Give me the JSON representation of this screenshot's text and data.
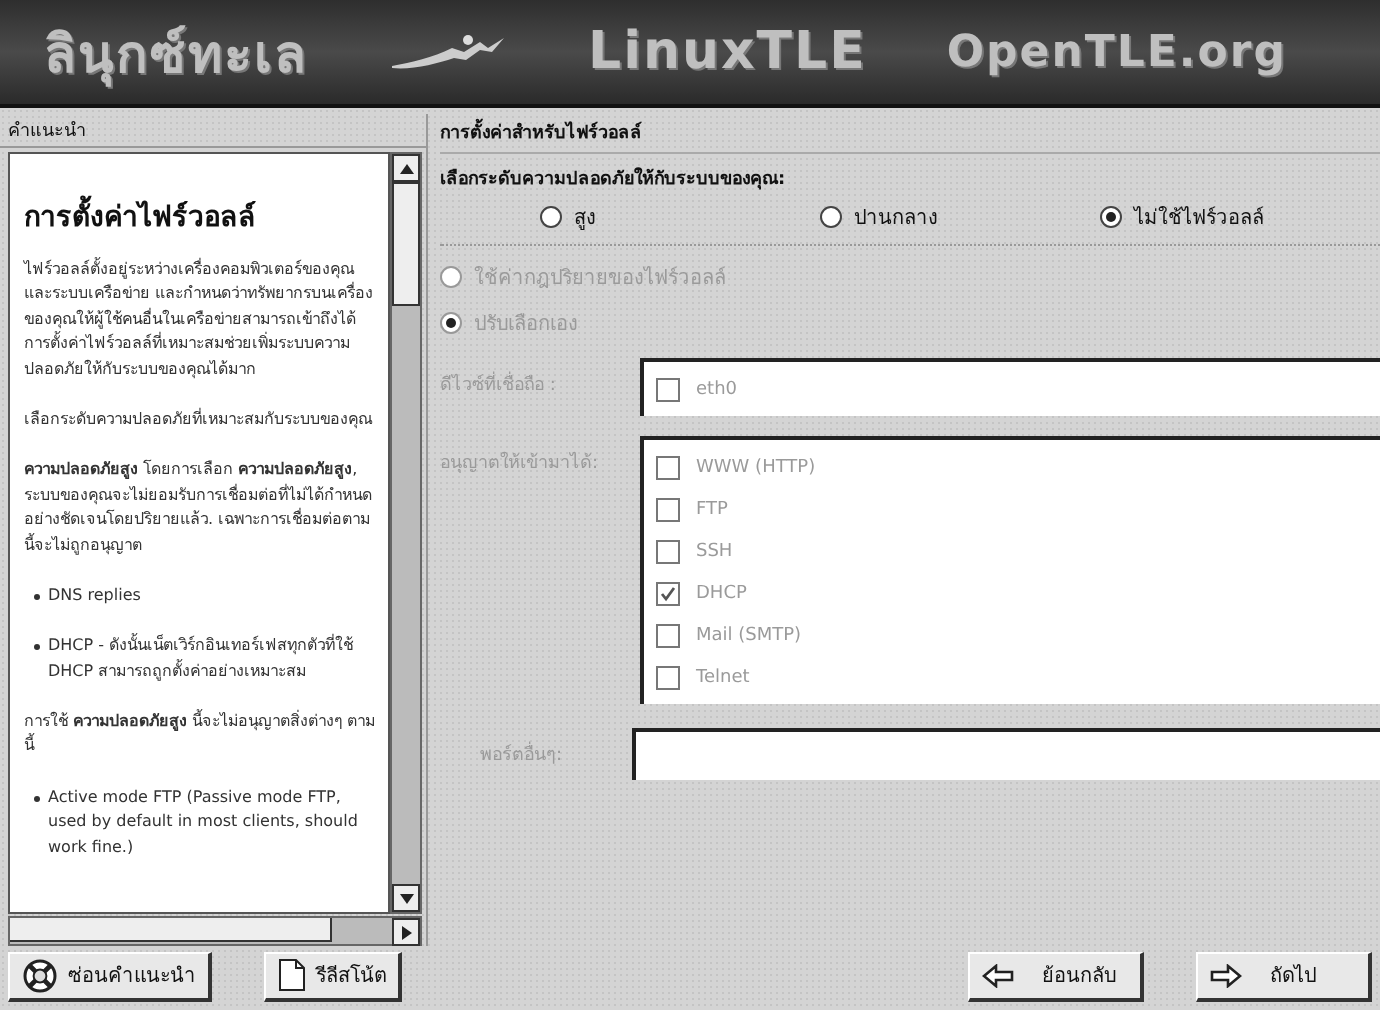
{
  "banner": {
    "title_thai": "ลินุกซ์ทะเล",
    "title_linux": "LinuxTLE",
    "site": "OpenTLE.org"
  },
  "help": {
    "header": "คำแนะนำ",
    "title": "การตั้งค่าไฟร์วอลล์",
    "blocks": [
      {
        "kind": "para",
        "text": "ไฟร์วอลล์ตั้งอยู่ระหว่างเครื่องคอมพิวเตอร์ของคุณและระบบเครือข่าย และกำหนดว่าทรัพยากรบนเครื่องของคุณให้ผู้ใช้คนอื่นในเครือข่ายสามารถเข้าถึงได้ การตั้งค่าไฟร์วอลล์ที่เหมาะสมช่วยเพิ่มระบบความปลอดภัยให้กับระบบของคุณได้มาก"
      },
      {
        "kind": "para",
        "text": "เลือกระดับความปลอดภัยที่เหมาะสมกับระบบของคุณ"
      },
      {
        "kind": "para",
        "text": "**ความปลอดภัยสูง** โดยการเลือก **ความปลอดภัยสูง**, ระบบของคุณจะไม่ยอมรับการเชื่อมต่อที่ไม่ได้กำหนดอย่างชัดเจนโดยปริยายแล้ว. เฉพาะการเชื่อมต่อตามนี้จะไม่ถูกอนุญาต"
      },
      {
        "kind": "bullet",
        "text": "DNS replies"
      },
      {
        "kind": "bullet",
        "text": "DHCP - ดังนั้นเน็ตเวิร์กอินเทอร์เฟสทุกตัวที่ใช้ DHCP สามารถถูกตั้งค่าอย่างเหมาะสม"
      },
      {
        "kind": "para",
        "text": "การใช้ **ความปลอดภัยสูง** นี้จะไม่อนุญาตสิ่งต่างๆ ตามนี้"
      },
      {
        "kind": "bullet",
        "text": "Active mode FTP (Passive mode FTP, used by default in most clients, should work fine.)"
      }
    ]
  },
  "buttons_left": [
    {
      "label": "ซ่อนคำแนะนำ"
    },
    {
      "label": "รีลีสโน้ต"
    }
  ],
  "buttons_right": [
    {
      "label": "ย้อนกลับ"
    },
    {
      "label": "ถัดไป"
    }
  ],
  "firewall": {
    "header": "การตั้งค่าสำหรับไฟร์วอลล์",
    "prompt": "เลือกระดับความปลอดภัยให้กับระบบของคุณ:",
    "levels": [
      {
        "label": "สูง",
        "selected": false
      },
      {
        "label": "ปานกลาง",
        "selected": false
      },
      {
        "label": "ไม่ใช้ไฟร์วอลล์",
        "selected": true
      }
    ],
    "custom": {
      "disabled": true,
      "modes": [
        {
          "label": "ใช้ค่ากฎปริยายของไฟร์วอลล์",
          "selected": false
        },
        {
          "label": "ปรับเลือกเอง",
          "selected": true
        }
      ],
      "trusted_label": "ดีไวซ์ที่เชื่อถือ :",
      "trusted": [
        {
          "label": "eth0",
          "checked": false
        }
      ],
      "incoming_label": "อนุญาตให้เข้ามาได้:",
      "incoming": [
        {
          "label": "WWW (HTTP)",
          "checked": false
        },
        {
          "label": "FTP",
          "checked": false
        },
        {
          "label": "SSH",
          "checked": false
        },
        {
          "label": "DHCP",
          "checked": true
        },
        {
          "label": "Mail (SMTP)",
          "checked": false
        },
        {
          "label": "Telnet",
          "checked": false
        }
      ],
      "ports_label": "พอร์ตอื่นๆ:"
    }
  }
}
